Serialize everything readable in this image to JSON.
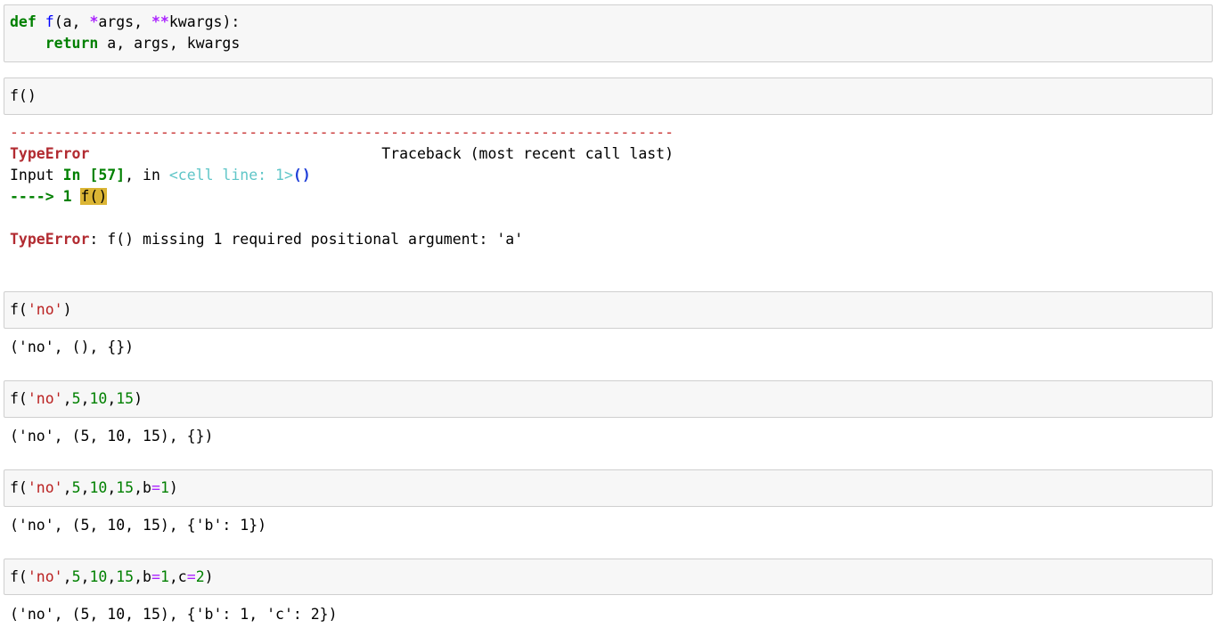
{
  "cells": {
    "c1": {
      "line1": {
        "kw": "def",
        "fn": "f",
        "open": "(a, ",
        "star": "*",
        "args": "args, ",
        "dstar": "**",
        "kwargs": "kwargs):"
      },
      "line2": {
        "indent": "    ",
        "kw": "return",
        "rest": " a, args, kwargs"
      }
    },
    "c2": {
      "code": "f()",
      "traceback": {
        "dashes": "---------------------------------------------------------------------------",
        "error_name": "TypeError",
        "traceback_gap": "                                 ",
        "traceback_label": "Traceback (most recent call last)",
        "input_prefix": "Input ",
        "in_label": "In [57]",
        "in_mid": ", in ",
        "cell_ref": "<cell line: 1>",
        "parens": "()",
        "arrow": "----> 1 ",
        "hl_code": "f()",
        "final_error_name": "TypeError",
        "final_message": ": f() missing 1 required positional argument: 'a'"
      }
    },
    "c3": {
      "code": {
        "f": "f(",
        "s1": "'no'",
        "close": ")"
      },
      "output": "('no', (), {})"
    },
    "c4": {
      "code": {
        "f": "f(",
        "s1": "'no'",
        "c1": ",",
        "n1": "5",
        "c2": ",",
        "n2": "10",
        "c3": ",",
        "n3": "15",
        "close": ")"
      },
      "output": "('no', (5, 10, 15), {})"
    },
    "c5": {
      "code": {
        "f": "f(",
        "s1": "'no'",
        "c1": ",",
        "n1": "5",
        "c2": ",",
        "n2": "10",
        "c3": ",",
        "n3": "15",
        "c4": ",b",
        "eq": "=",
        "n4": "1",
        "close": ")"
      },
      "output": "('no', (5, 10, 15), {'b': 1})"
    },
    "c6": {
      "code": {
        "f": "f(",
        "s1": "'no'",
        "c1": ",",
        "n1": "5",
        "c2": ",",
        "n2": "10",
        "c3": ",",
        "n3": "15",
        "c4": ",b",
        "eq1": "=",
        "n4": "1",
        "c5": ",c",
        "eq2": "=",
        "n5": "2",
        "close": ")"
      },
      "output": "('no', (5, 10, 15), {'b': 1, 'c': 2})"
    }
  }
}
